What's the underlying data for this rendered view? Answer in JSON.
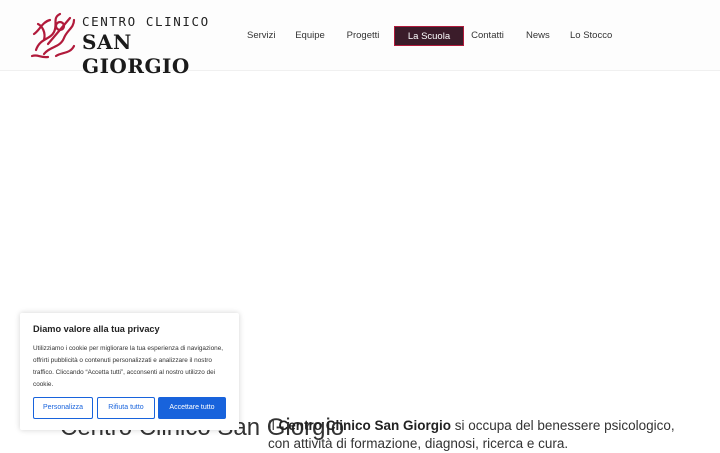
{
  "header": {
    "logo": {
      "line1": "CENTRO CLINICO",
      "line2": "SAN GIORGIO"
    },
    "nav": [
      {
        "label": "Servizi",
        "active": false
      },
      {
        "label": "Equipe",
        "active": false
      },
      {
        "label": "Progetti",
        "active": false
      },
      {
        "label": "La Scuola",
        "active": true
      },
      {
        "label": "Contatti",
        "active": false
      },
      {
        "label": "News",
        "active": false
      },
      {
        "label": "Lo Stocco",
        "active": false
      }
    ]
  },
  "hero": {
    "title": "Centro Clinico San Giorgio",
    "intro_prefix": "Il ",
    "intro_bold": "Centro Clinico San Giorgio",
    "intro_rest": " si occupa del benessere psicologico, con attività di formazione, diagnosi, ricerca e cura."
  },
  "cookie_banner": {
    "title": "Diamo valore alla tua privacy",
    "text": "Utilizziamo i cookie per migliorare la tua esperienza di navigazione, offrirti pubblicità o contenuti personalizzati e analizzare il nostro traffico. Cliccando “Accetta tutti”, acconsenti al nostro utilizzo dei cookie.",
    "customize_label": "Personalizza",
    "reject_label": "Rifiuta tutto",
    "accept_label": "Accettare tutto"
  },
  "colors": {
    "brand_red": "#b11a3b",
    "active_nav_bg": "#3b1c2a",
    "cookie_blue": "#1863dc"
  }
}
